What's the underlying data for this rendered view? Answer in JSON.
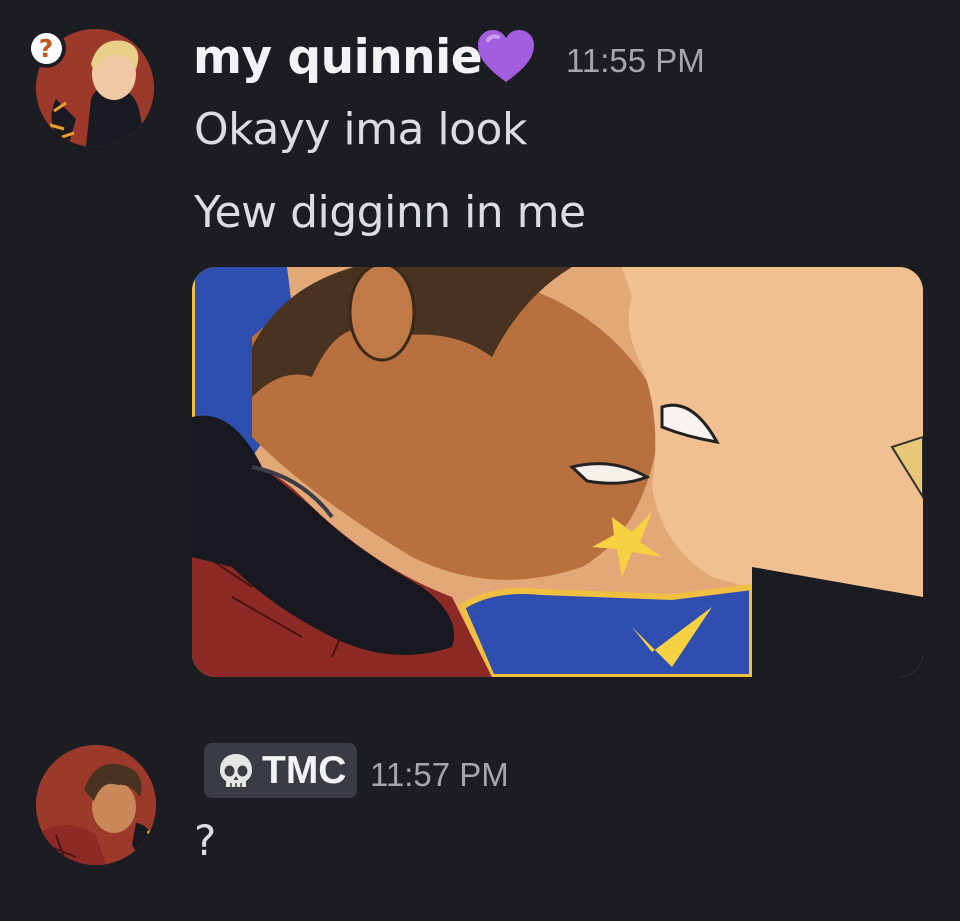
{
  "messages": [
    {
      "author": "my quinnie",
      "author_emoji": "purple-heart",
      "timestamp": "11:55 PM",
      "lines": [
        "Okayy ima look",
        "Yew digginn in me"
      ],
      "has_image_attachment": true,
      "avatar_badge": "?"
    },
    {
      "author_tag": "TMC",
      "author_tag_icon": "skull-icon",
      "timestamp": "11:57 PM",
      "lines": [
        "?"
      ]
    }
  ],
  "colors": {
    "background": "#1c1d22",
    "username": "#f2f3f5",
    "message_text": "#dbdee1",
    "timestamp": "#a3a6aa",
    "tag_background": "#3a3c43",
    "heart": "#a35ee0"
  }
}
